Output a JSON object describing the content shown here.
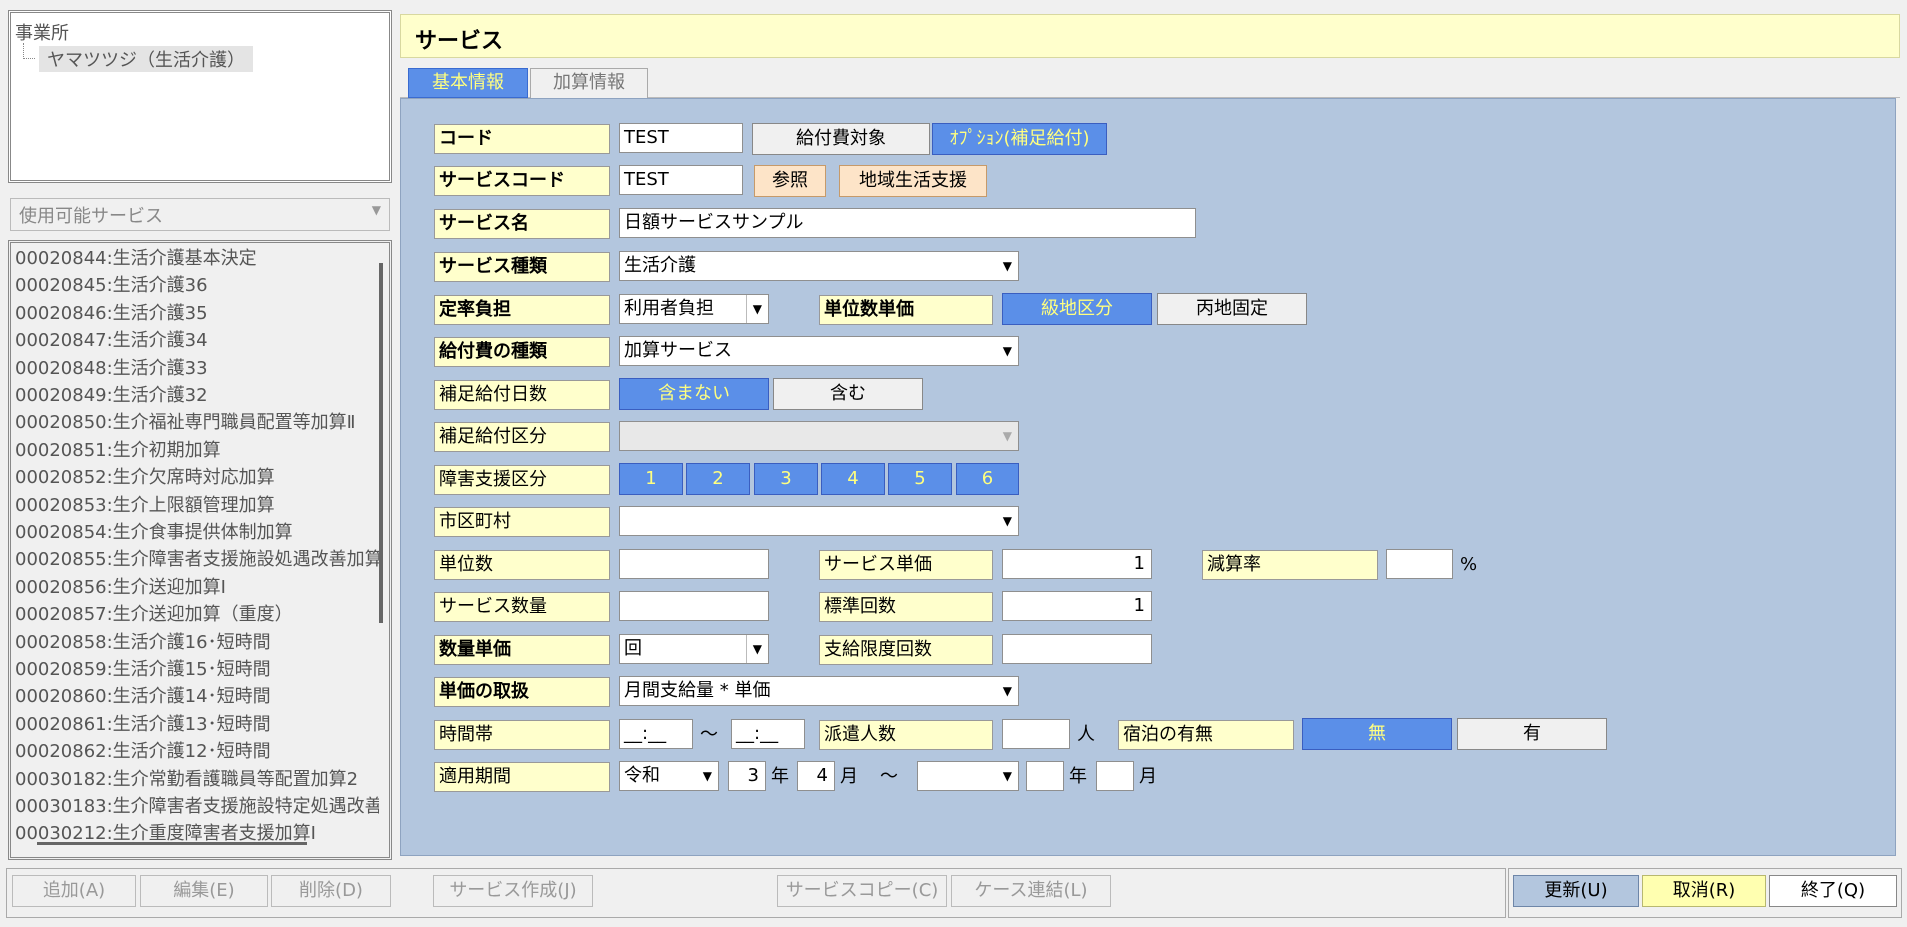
{
  "tree": {
    "root": "事業所",
    "child": "ヤマツツジ（生活介護）"
  },
  "service_combo": {
    "value": "使用可能サービス"
  },
  "service_list": [
    "00020844:生活介護基本決定",
    "00020845:生活介護36",
    "00020846:生活介護35",
    "00020847:生活介護34",
    "00020848:生活介護33",
    "00020849:生活介護32",
    "00020850:生介福祉専門職員配置等加算Ⅱ",
    "00020851:生介初期加算",
    "00020852:生介欠席時対応加算",
    "00020853:生介上限額管理加算",
    "00020854:生介食事提供体制加算",
    "00020855:生介障害者支援施設処遇改善加算",
    "00020856:生介送迎加算Ⅰ",
    "00020857:生介送迎加算（重度）",
    "00020858:生活介護16･短時間",
    "00020859:生活介護15･短時間",
    "00020860:生活介護14･短時間",
    "00020861:生活介護13･短時間",
    "00020862:生活介護12･短時間",
    "00030182:生介常勤看護職員等配置加算2",
    "00030183:生介障害者支援施設特定処遇改善",
    "00030212:生介重度障害者支援加算Ⅰ"
  ],
  "header": {
    "title": "サービス"
  },
  "tabs": {
    "basic": "基本情報",
    "addition": "加算情報"
  },
  "labels": {
    "code": "コード",
    "service_code": "サービスコード",
    "service_name": "サービス名",
    "service_type": "サービス種類",
    "fixed_rate": "定率負担",
    "unit_price": "単位数単価",
    "benefit_type": "給付費の種類",
    "supp_days": "補足給付日数",
    "supp_category": "補足給付区分",
    "disability_level": "障害支援区分",
    "municipality": "市区町村",
    "units": "単位数",
    "service_unit_price": "サービス単価",
    "reduction_rate": "減算率",
    "service_quantity": "サービス数量",
    "standard_count": "標準回数",
    "quantity_unit_price": "数量単価",
    "payment_limit": "支給限度回数",
    "price_handling": "単価の取扱",
    "time_zone": "時間帯",
    "dispatch_count": "派遣人数",
    "overnight": "宿泊の有無",
    "period": "適用期間"
  },
  "values": {
    "code": "TEST",
    "service_code": "TEST",
    "service_name": "日額サービスサンプル",
    "service_type": "生活介護",
    "fixed_rate": "利用者負担",
    "benefit_type": "加算サービス",
    "supp_category": "",
    "municipality": "",
    "units": "",
    "service_unit_price": "1",
    "reduction_rate": "",
    "service_quantity": "",
    "standard_count": "1",
    "quantity_unit_price": "回",
    "payment_limit": "",
    "price_handling": "月間支給量 * 単価",
    "time_from": "__:__",
    "time_to": "__:__",
    "dispatch_count": "",
    "period_era": "令和",
    "period_from_year": "3",
    "period_from_month": "4",
    "period_to_era": "",
    "period_to_year": "",
    "period_to_month": ""
  },
  "buttons": {
    "benefit_target": "給付費対象",
    "option_supp": "ｵﾌﾟｼｮﾝ(補足給付)",
    "reference": "参照",
    "regional_support": "地域生活支援",
    "grade_area": "級地区分",
    "fixed_area": "丙地固定",
    "not_included": "含まない",
    "included": "含む",
    "level_1": "1",
    "level_2": "2",
    "level_3": "3",
    "level_4": "4",
    "level_5": "5",
    "level_6": "6",
    "overnight_no": "無",
    "overnight_yes": "有"
  },
  "units_text": {
    "percent": "%",
    "tilde": "～",
    "person": "人",
    "year": "年",
    "month": "月"
  },
  "bottom": {
    "add": "追加(A)",
    "edit": "編集(E)",
    "delete": "削除(D)",
    "create_service": "サービス作成(J)",
    "copy_service": "サービスコピー(C)",
    "case_link": "ケース連結(L)",
    "update": "更新(U)",
    "cancel": "取消(R)",
    "exit": "終了(Q)"
  },
  "colors": {
    "accent_blue": "#5b8fe8",
    "form_bg": "#b3c6de",
    "label_bg": "#ffffcc",
    "header_bg": "#ffffcc"
  }
}
